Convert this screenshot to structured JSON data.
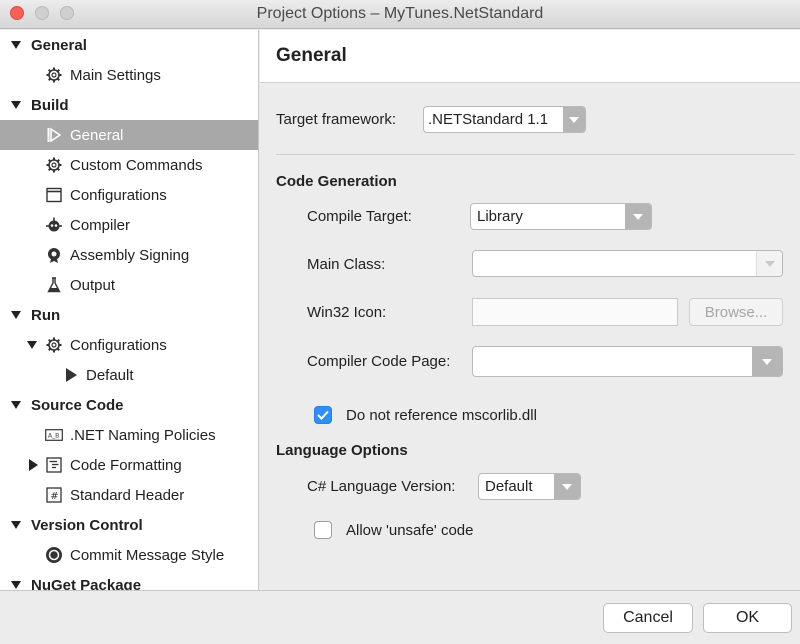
{
  "window": {
    "title": "Project Options – MyTunes.NetStandard"
  },
  "sidebar": {
    "general_section": "General",
    "main_settings": "Main Settings",
    "build_section": "Build",
    "build_general": "General",
    "custom_commands": "Custom Commands",
    "configurations": "Configurations",
    "compiler": "Compiler",
    "assembly_signing": "Assembly Signing",
    "output": "Output",
    "run_section": "Run",
    "run_configurations": "Configurations",
    "default": "Default",
    "source_code_section": "Source Code",
    "net_naming": ".NET Naming Policies",
    "code_formatting": "Code Formatting",
    "standard_header": "Standard Header",
    "version_control_section": "Version Control",
    "commit_message_style": "Commit Message Style",
    "nuget_section": "NuGet Package"
  },
  "main": {
    "header": "General",
    "target_framework_label": "Target framework:",
    "target_framework_value": ".NETStandard 1.1",
    "code_generation_heading": "Code Generation",
    "compile_target_label": "Compile Target:",
    "compile_target_value": "Library",
    "main_class_label": "Main Class:",
    "main_class_value": "",
    "win32_icon_label": "Win32 Icon:",
    "win32_icon_value": "",
    "browse_label": "Browse...",
    "compiler_code_page_label": "Compiler Code Page:",
    "compiler_code_page_value": "",
    "no_mscorlib_label": "Do not reference mscorlib.dll",
    "no_mscorlib_checked": true,
    "language_options_heading": "Language Options",
    "csharp_version_label": "C# Language Version:",
    "csharp_version_value": "Default",
    "allow_unsafe_label": "Allow 'unsafe' code",
    "allow_unsafe_checked": false
  },
  "footer": {
    "cancel_label": "Cancel",
    "ok_label": "OK"
  },
  "colors": {
    "selection": "#a8a8a8",
    "checkbox_accent": "#2f8ff5",
    "close_button": "#fc5f57"
  }
}
